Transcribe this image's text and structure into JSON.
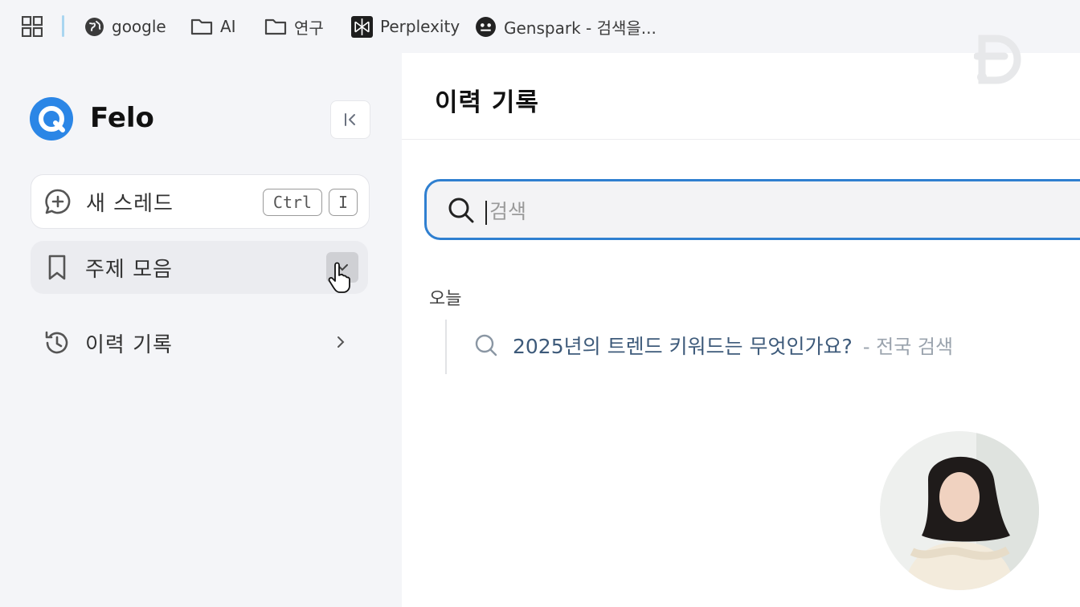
{
  "bookmarks_bar": {
    "items": [
      {
        "label": "google",
        "icon": "globe-icon"
      },
      {
        "label": "AI",
        "icon": "folder-icon"
      },
      {
        "label": "연구",
        "icon": "folder-icon"
      },
      {
        "label": "Perplexity",
        "icon": "perplexity-icon"
      },
      {
        "label": "Genspark - 검색을...",
        "icon": "genspark-icon"
      }
    ]
  },
  "sidebar": {
    "brand": "Felo",
    "new_thread": {
      "label": "새 스레드",
      "shortcut_keys": [
        "Ctrl",
        "I"
      ]
    },
    "topics": {
      "label": "주제 모음"
    },
    "history": {
      "label": "이력 기록"
    }
  },
  "main": {
    "title": "이력 기록",
    "search": {
      "placeholder": "검색",
      "value": ""
    },
    "section_label": "오늘",
    "history_items": [
      {
        "query": "2025년의 트렌드 키워드는 무엇인가요?",
        "source": "- 전국 검색"
      }
    ]
  },
  "colors": {
    "accent": "#2f7fd0",
    "logo": "#2b86e6",
    "background": "#f4f5f8"
  }
}
